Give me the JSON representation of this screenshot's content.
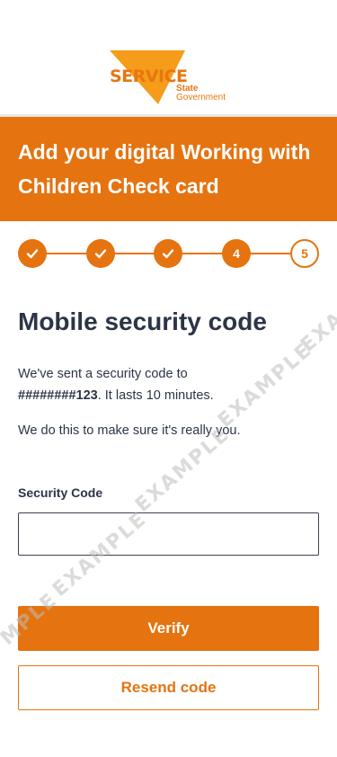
{
  "logo": {
    "word": "SERVICE",
    "line1": "State",
    "line2": "Government"
  },
  "banner": {
    "title": "Add your digital Working with Children Check card"
  },
  "stepper": {
    "steps": [
      "",
      "",
      "",
      "4",
      "5"
    ],
    "current": "4"
  },
  "content": {
    "heading": "Mobile security code",
    "sent_text": "We've sent a security code to",
    "masked_number": "########123",
    "lasts_text": ". It lasts 10 minutes.",
    "reason_text": "We do this to make sure it's really you."
  },
  "form": {
    "security_code_label": "Security Code",
    "security_code_value": ""
  },
  "buttons": {
    "verify": "Verify",
    "resend": "Resend code"
  },
  "watermark": {
    "text_a": "EXAMPLE",
    "text_b": "EXAMPLE",
    "text_c": "EXAMPLE",
    "text_d": "EXAMPLE",
    "text_e": "MPLE",
    "text_f": "EXAM"
  },
  "colors": {
    "accent": "#e5730f",
    "text": "#2b3547"
  }
}
